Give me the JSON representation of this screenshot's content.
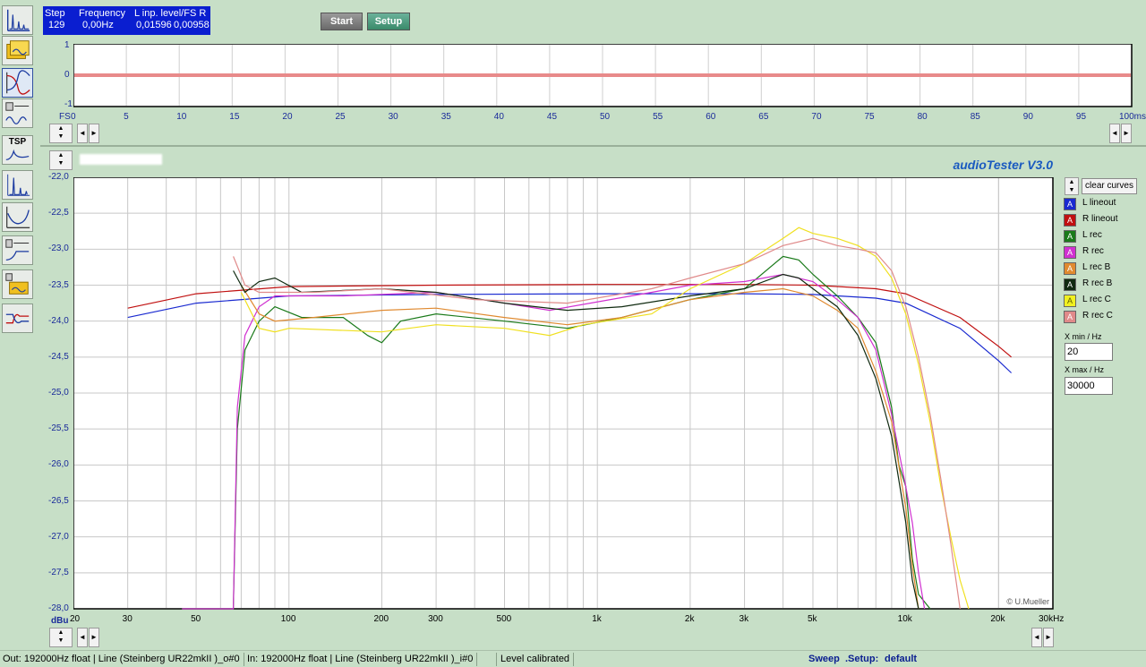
{
  "status": {
    "step_label": "Step",
    "step_value": "129",
    "frequency_label": "Frequency",
    "frequency_value": "0,00Hz",
    "level_label": "L  inp. level/FS  R",
    "level_left": "0,01596",
    "level_right": "0,00958"
  },
  "toolbar": {
    "start_label": "Start",
    "setup_label": "Setup",
    "tsp_label": "TSP"
  },
  "scope": {
    "y_ticks": [
      "1",
      "0",
      "-1"
    ],
    "x_unit_left": "FS",
    "x_ticks": [
      "0",
      "5",
      "10",
      "15",
      "20",
      "25",
      "30",
      "35",
      "40",
      "45",
      "50",
      "55",
      "60",
      "65",
      "70",
      "75",
      "80",
      "85",
      "90",
      "95",
      "100ms"
    ]
  },
  "app_title": "audioTester  V3.0",
  "copyright": "© U.Mueller",
  "chart_data": {
    "type": "line",
    "title": "",
    "xlabel": "",
    "ylabel": "dBu",
    "x_scale": "log",
    "xlim": [
      20,
      30000
    ],
    "ylim": [
      -28.0,
      -22.0
    ],
    "x_tick_labels": [
      "20",
      "30",
      "50",
      "100",
      "200",
      "300",
      "500",
      "1k",
      "2k",
      "3k",
      "5k",
      "10k",
      "20k",
      "30kHz"
    ],
    "y_tick_labels": [
      "-22,0",
      "-22,5",
      "-23,0",
      "-23,5",
      "-24,0",
      "-24,5",
      "-25,0",
      "-25,5",
      "-26,0",
      "-26,5",
      "-27,0",
      "-27,5",
      "-28,0"
    ],
    "grid": true,
    "legend_position": "right",
    "series": [
      {
        "name": "L lineout",
        "color": "#1a2ad0",
        "points": [
          [
            30,
            -23.95
          ],
          [
            50,
            -23.75
          ],
          [
            100,
            -23.65
          ],
          [
            300,
            -23.63
          ],
          [
            1000,
            -23.62
          ],
          [
            3000,
            -23.62
          ],
          [
            5000,
            -23.63
          ],
          [
            8000,
            -23.68
          ],
          [
            10000,
            -23.75
          ],
          [
            15000,
            -24.1
          ],
          [
            20000,
            -24.55
          ],
          [
            22000,
            -24.72
          ]
        ]
      },
      {
        "name": "R lineout",
        "color": "#c01010",
        "points": [
          [
            30,
            -23.82
          ],
          [
            50,
            -23.62
          ],
          [
            100,
            -23.52
          ],
          [
            300,
            -23.5
          ],
          [
            1000,
            -23.49
          ],
          [
            3000,
            -23.49
          ],
          [
            5000,
            -23.5
          ],
          [
            8000,
            -23.55
          ],
          [
            10000,
            -23.62
          ],
          [
            15000,
            -23.95
          ],
          [
            20000,
            -24.35
          ],
          [
            22000,
            -24.5
          ]
        ]
      },
      {
        "name": "L rec",
        "color": "#1a7a1a",
        "points": [
          [
            45,
            -28.0
          ],
          [
            66,
            -28.0
          ],
          [
            68,
            -25.5
          ],
          [
            72,
            -24.4
          ],
          [
            80,
            -24.0
          ],
          [
            90,
            -23.8
          ],
          [
            110,
            -23.95
          ],
          [
            150,
            -23.95
          ],
          [
            180,
            -24.2
          ],
          [
            200,
            -24.3
          ],
          [
            230,
            -24.0
          ],
          [
            300,
            -23.9
          ],
          [
            500,
            -24.0
          ],
          [
            800,
            -24.1
          ],
          [
            1200,
            -23.95
          ],
          [
            2000,
            -23.7
          ],
          [
            3000,
            -23.55
          ],
          [
            4000,
            -23.1
          ],
          [
            4500,
            -23.15
          ],
          [
            5000,
            -23.35
          ],
          [
            6000,
            -23.65
          ],
          [
            7000,
            -23.95
          ],
          [
            8000,
            -24.3
          ],
          [
            9000,
            -25.2
          ],
          [
            9500,
            -26.0
          ],
          [
            10000,
            -26.3
          ],
          [
            10500,
            -27.3
          ],
          [
            11000,
            -27.8
          ],
          [
            12000,
            -28.0
          ]
        ]
      },
      {
        "name": "R rec",
        "color": "#d030d0",
        "points": [
          [
            45,
            -28.0
          ],
          [
            66,
            -28.0
          ],
          [
            68,
            -25.2
          ],
          [
            72,
            -24.2
          ],
          [
            80,
            -23.8
          ],
          [
            90,
            -23.65
          ],
          [
            150,
            -23.65
          ],
          [
            300,
            -23.6
          ],
          [
            700,
            -23.85
          ],
          [
            1500,
            -23.6
          ],
          [
            2000,
            -23.5
          ],
          [
            3000,
            -23.45
          ],
          [
            4000,
            -23.35
          ],
          [
            5000,
            -23.45
          ],
          [
            6000,
            -23.7
          ],
          [
            7000,
            -23.95
          ],
          [
            8000,
            -24.4
          ],
          [
            9000,
            -25.3
          ],
          [
            10000,
            -26.3
          ],
          [
            10500,
            -26.8
          ],
          [
            11000,
            -27.5
          ],
          [
            11500,
            -28.0
          ]
        ]
      },
      {
        "name": "L rec B",
        "color": "#e08a30",
        "points": [
          [
            70,
            -23.5
          ],
          [
            80,
            -23.9
          ],
          [
            90,
            -24.0
          ],
          [
            120,
            -23.95
          ],
          [
            200,
            -23.85
          ],
          [
            300,
            -23.82
          ],
          [
            500,
            -23.95
          ],
          [
            800,
            -24.05
          ],
          [
            1200,
            -23.95
          ],
          [
            2000,
            -23.7
          ],
          [
            3000,
            -23.6
          ],
          [
            4000,
            -23.55
          ],
          [
            5000,
            -23.65
          ],
          [
            6000,
            -23.85
          ],
          [
            7000,
            -24.1
          ],
          [
            8000,
            -24.7
          ],
          [
            9000,
            -25.4
          ],
          [
            10000,
            -26.6
          ],
          [
            10500,
            -27.4
          ],
          [
            11000,
            -28.0
          ]
        ]
      },
      {
        "name": "R rec B",
        "color": "#102a10",
        "points": [
          [
            66,
            -23.3
          ],
          [
            72,
            -23.6
          ],
          [
            80,
            -23.45
          ],
          [
            90,
            -23.4
          ],
          [
            110,
            -23.6
          ],
          [
            200,
            -23.55
          ],
          [
            300,
            -23.6
          ],
          [
            500,
            -23.75
          ],
          [
            800,
            -23.85
          ],
          [
            1200,
            -23.8
          ],
          [
            2000,
            -23.65
          ],
          [
            3000,
            -23.55
          ],
          [
            4000,
            -23.35
          ],
          [
            4500,
            -23.4
          ],
          [
            5000,
            -23.55
          ],
          [
            6000,
            -23.8
          ],
          [
            7000,
            -24.2
          ],
          [
            8000,
            -24.8
          ],
          [
            9000,
            -25.6
          ],
          [
            10000,
            -26.8
          ],
          [
            10500,
            -27.6
          ],
          [
            11000,
            -28.0
          ]
        ]
      },
      {
        "name": "L rec C",
        "color": "#f0e020",
        "points": [
          [
            70,
            -23.6
          ],
          [
            80,
            -24.1
          ],
          [
            90,
            -24.15
          ],
          [
            100,
            -24.1
          ],
          [
            200,
            -24.15
          ],
          [
            300,
            -24.05
          ],
          [
            500,
            -24.1
          ],
          [
            700,
            -24.2
          ],
          [
            900,
            -24.05
          ],
          [
            1500,
            -23.9
          ],
          [
            2000,
            -23.55
          ],
          [
            3000,
            -23.2
          ],
          [
            4000,
            -22.85
          ],
          [
            4500,
            -22.7
          ],
          [
            5000,
            -22.78
          ],
          [
            6000,
            -22.85
          ],
          [
            7000,
            -22.95
          ],
          [
            8000,
            -23.1
          ],
          [
            9000,
            -23.4
          ],
          [
            10000,
            -23.9
          ],
          [
            11000,
            -24.6
          ],
          [
            12000,
            -25.4
          ],
          [
            13000,
            -26.3
          ],
          [
            14000,
            -27.0
          ],
          [
            15000,
            -27.6
          ],
          [
            16000,
            -28.0
          ]
        ]
      },
      {
        "name": "R rec C",
        "color": "#e08a8a",
        "points": [
          [
            66,
            -23.1
          ],
          [
            72,
            -23.5
          ],
          [
            80,
            -23.6
          ],
          [
            120,
            -23.6
          ],
          [
            200,
            -23.55
          ],
          [
            400,
            -23.7
          ],
          [
            800,
            -23.75
          ],
          [
            1500,
            -23.55
          ],
          [
            2000,
            -23.4
          ],
          [
            3000,
            -23.2
          ],
          [
            4000,
            -22.95
          ],
          [
            5000,
            -22.85
          ],
          [
            6000,
            -22.95
          ],
          [
            7000,
            -23.0
          ],
          [
            8000,
            -23.05
          ],
          [
            9000,
            -23.3
          ],
          [
            10000,
            -23.8
          ],
          [
            11000,
            -24.5
          ],
          [
            12000,
            -25.3
          ],
          [
            13000,
            -26.2
          ],
          [
            14000,
            -27.1
          ],
          [
            15000,
            -28.0
          ]
        ]
      }
    ]
  },
  "legend": {
    "clear_label": "clear curves",
    "items": [
      {
        "letter": "A",
        "name": "L lineout",
        "swatch": "#1a2ad0",
        "letter_color": "#ffffff"
      },
      {
        "letter": "A",
        "name": "R lineout",
        "swatch": "#c01010",
        "letter_color": "#ffffff"
      },
      {
        "letter": "A",
        "name": "L rec",
        "swatch": "#1a7a1a",
        "letter_color": "#ffffff"
      },
      {
        "letter": "A",
        "name": "R rec",
        "swatch": "#d030d0",
        "letter_color": "#ffffff"
      },
      {
        "letter": "A",
        "name": "L rec B",
        "swatch": "#e08a30",
        "letter_color": "#ffffff"
      },
      {
        "letter": "A",
        "name": "R rec B",
        "swatch": "#102a10",
        "letter_color": "#ffffff"
      },
      {
        "letter": "A",
        "name": "L rec C",
        "swatch": "#f0f020",
        "letter_color": "#606000"
      },
      {
        "letter": "A",
        "name": "R rec C",
        "swatch": "#e08a8a",
        "letter_color": "#ffffff"
      }
    ],
    "xmin_label": "X min / Hz",
    "xmin_value": "20",
    "xmax_label": "X max / Hz",
    "xmax_value": "30000"
  },
  "statusbar": {
    "out": "Out: 192000Hz float  | Line (Steinberg UR22mkII )_o#0",
    "in": "In: 192000Hz float  | Line (Steinberg UR22mkII )_i#0",
    "level": "Level calibrated",
    "sweep_label": "Sweep",
    "setup_label": ".Setup:",
    "setup_value": "default"
  }
}
